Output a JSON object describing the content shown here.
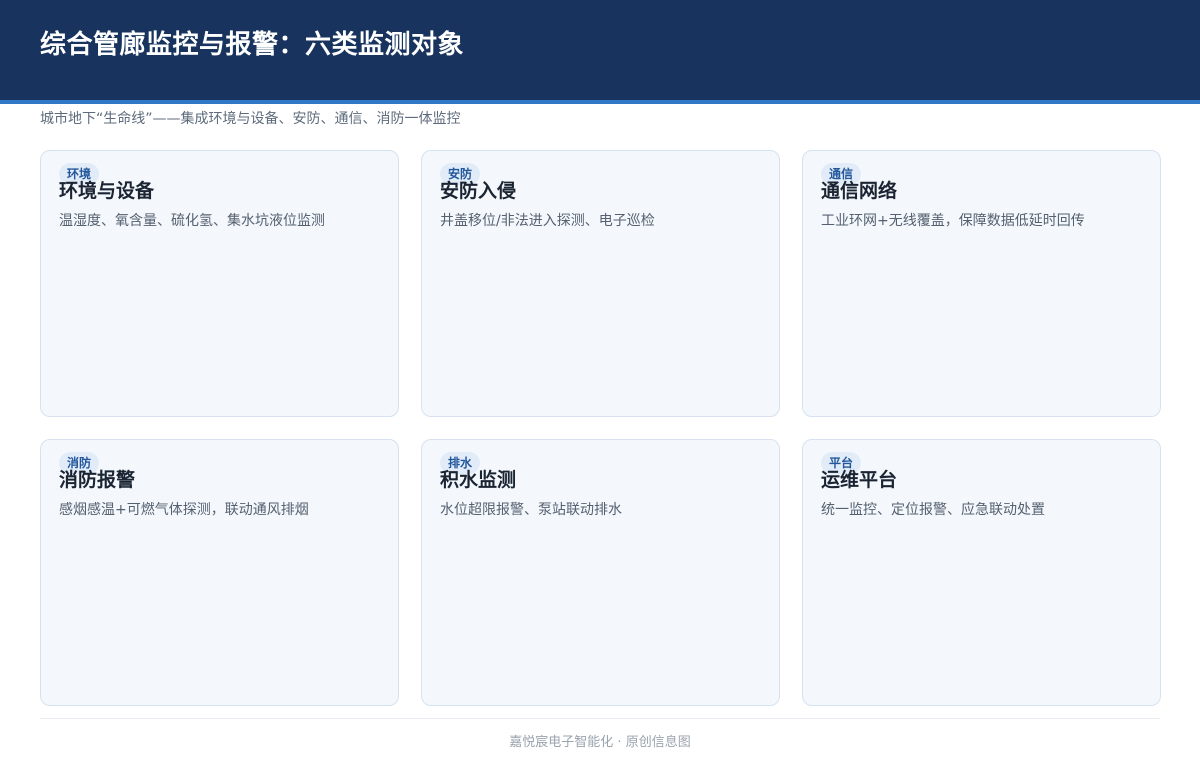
{
  "header": {
    "title": "综合管廊监控与报警：六类监测对象"
  },
  "subtitle": "城市地下“生命线”——集成环境与设备、安防、通信、消防一体监控",
  "cards": [
    {
      "tag": "环境",
      "title": "环境与设备",
      "desc": "温湿度、氧含量、硫化氢、集水坑液位监测"
    },
    {
      "tag": "安防",
      "title": "安防入侵",
      "desc": "井盖移位/非法进入探测、电子巡检"
    },
    {
      "tag": "通信",
      "title": "通信网络",
      "desc": "工业环网+无线覆盖，保障数据低延时回传"
    },
    {
      "tag": "消防",
      "title": "消防报警",
      "desc": "感烟感温+可燃气体探测，联动通风排烟"
    },
    {
      "tag": "排水",
      "title": "积水监测",
      "desc": "水位超限报警、泵站联动排水"
    },
    {
      "tag": "平台",
      "title": "运维平台",
      "desc": "统一监控、定位报警、应急联动处置"
    }
  ],
  "footer": "嘉悦宸电子智能化 · 原创信息图",
  "colors": {
    "header_bg": "#17335e",
    "accent": "#2f78c8",
    "card_bg": "#f4f8fc",
    "card_border": "#d6e2ef",
    "tag_text": "#22579c"
  }
}
